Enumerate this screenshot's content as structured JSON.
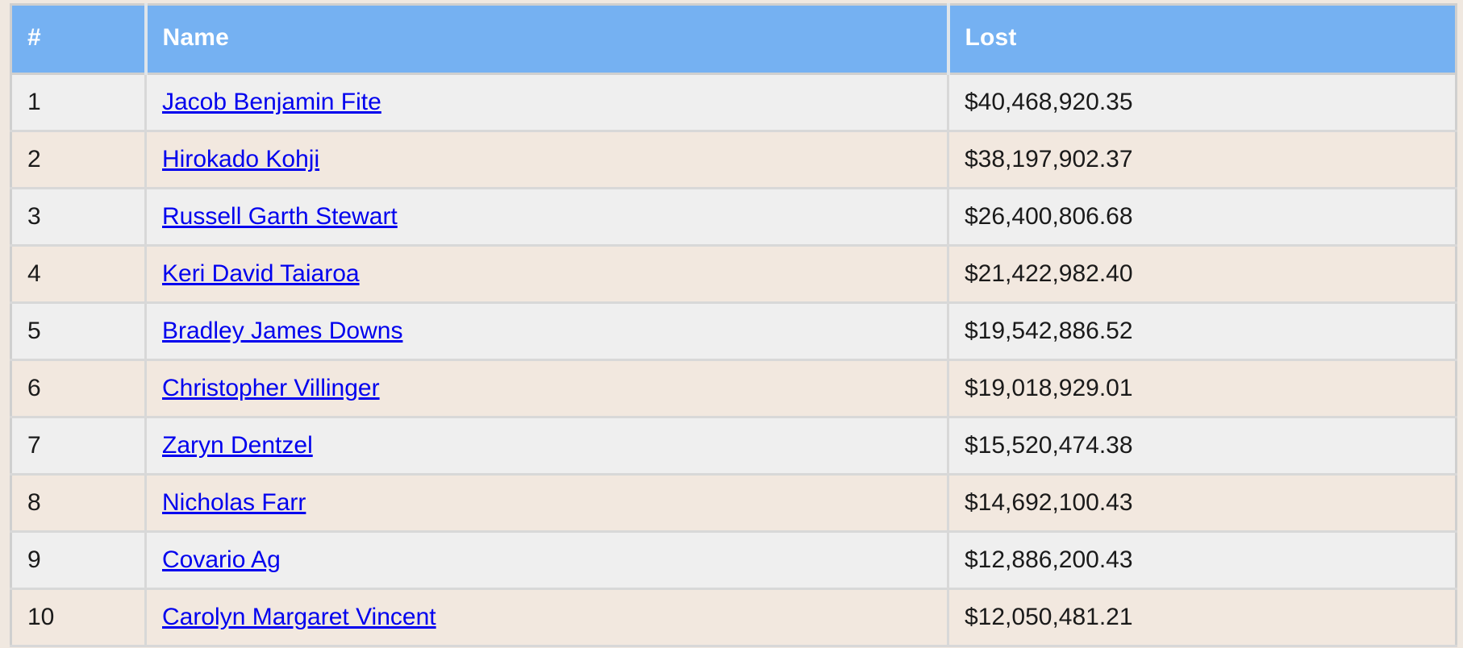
{
  "table": {
    "columns": [
      {
        "key": "rank",
        "label": "#"
      },
      {
        "key": "name",
        "label": "Name"
      },
      {
        "key": "lost",
        "label": "Lost"
      }
    ],
    "header_background": "#75b1f2",
    "header_text_color": "#ffffff",
    "link_color": "#0000ee",
    "row_odd_background": "#efefef",
    "row_even_background": "#f2e8df",
    "page_background": "#f0e8e0",
    "rows": [
      {
        "rank": "1",
        "name": "Jacob Benjamin Fite",
        "lost": "$40,468,920.35"
      },
      {
        "rank": "2",
        "name": "Hirokado Kohji",
        "lost": "$38,197,902.37"
      },
      {
        "rank": "3",
        "name": "Russell Garth Stewart",
        "lost": "$26,400,806.68"
      },
      {
        "rank": "4",
        "name": "Keri David Taiaroa",
        "lost": "$21,422,982.40"
      },
      {
        "rank": "5",
        "name": "Bradley James Downs",
        "lost": "$19,542,886.52"
      },
      {
        "rank": "6",
        "name": "Christopher Villinger",
        "lost": "$19,018,929.01"
      },
      {
        "rank": "7",
        "name": "Zaryn Dentzel",
        "lost": "$15,520,474.38"
      },
      {
        "rank": "8",
        "name": "Nicholas Farr",
        "lost": "$14,692,100.43"
      },
      {
        "rank": "9",
        "name": "Covario Ag",
        "lost": "$12,886,200.43"
      },
      {
        "rank": "10",
        "name": "Carolyn Margaret Vincent",
        "lost": "$12,050,481.21"
      }
    ]
  }
}
